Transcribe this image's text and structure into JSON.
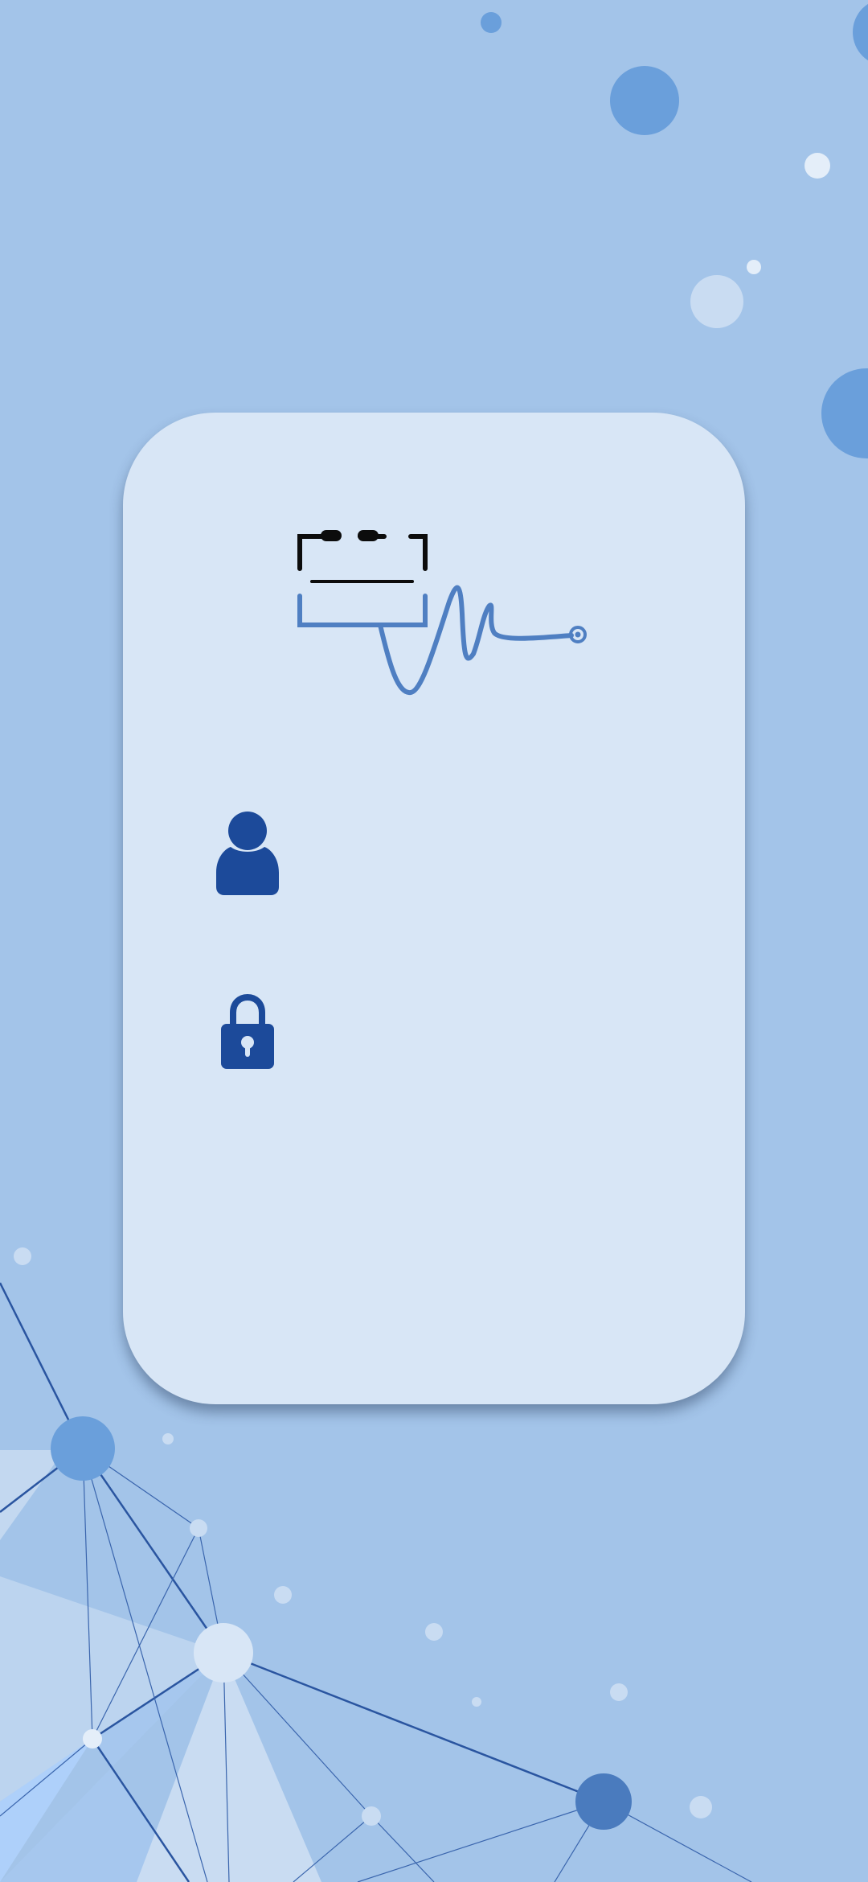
{
  "theme": {
    "background": "#a3c4e9",
    "card": "#d8e6f6",
    "accent_dark": "#1c4a9a",
    "accent_mid": "#4f7fc2",
    "logo_black": "#0c0c0c"
  },
  "logo": {
    "icon": "clipboard-stethoscope-logo-icon"
  },
  "login_form": {
    "username": {
      "icon": "user-icon",
      "value": "",
      "placeholder": ""
    },
    "password": {
      "icon": "lock-icon",
      "value": "",
      "placeholder": ""
    }
  }
}
